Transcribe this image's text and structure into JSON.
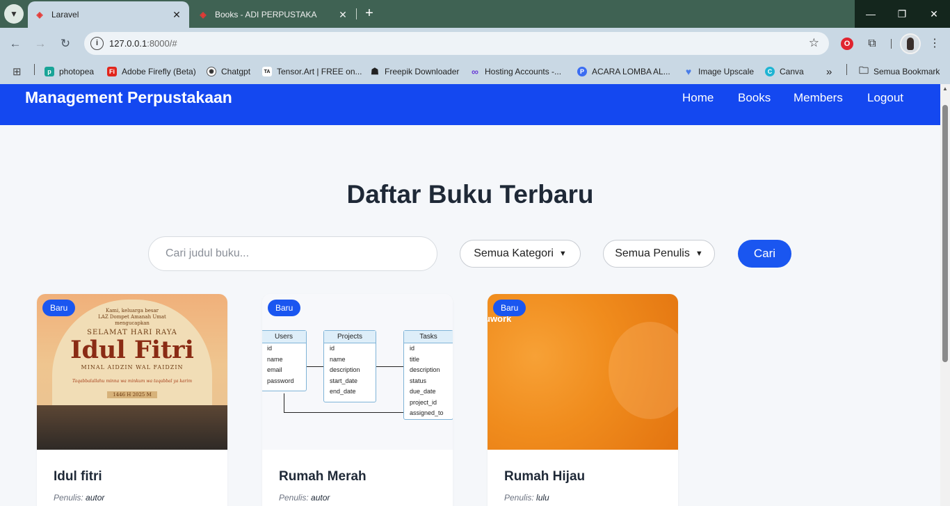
{
  "browser": {
    "tabs": [
      {
        "title": "Laravel",
        "active": true
      },
      {
        "title": "Books - ADI PERPUSTAKA",
        "active": false
      }
    ],
    "url_host": "127.0.0.1",
    "url_rest": ":8000/#",
    "bookmarks": [
      "photopea",
      "Adobe Firefly (Beta)",
      "Chatgpt",
      "Tensor.Art | FREE on...",
      "Freepik Downloader",
      "Hosting Accounts -...",
      "ACARA LOMBA AL...",
      "Image Upscale",
      "Canva"
    ],
    "all_bookmarks": "Semua Bookmark",
    "more_bookmarks": "»"
  },
  "navbar": {
    "brand": "Management Perpustakaan",
    "links": [
      "Home",
      "Books",
      "Members",
      "Logout"
    ]
  },
  "main": {
    "heading": "Daftar Buku Terbaru",
    "search_placeholder": "Cari judul buku...",
    "category_select": "Semua Kategori",
    "author_select": "Semua Penulis",
    "search_button": "Cari",
    "author_prefix": "Penulis:",
    "books": [
      {
        "badge": "Baru",
        "title": "Idul fitri",
        "author": "autor"
      },
      {
        "badge": "Baru",
        "title": "Rumah Merah",
        "author": "autor"
      },
      {
        "badge": "Baru",
        "title": "Rumah Hijau",
        "author": "lulu"
      }
    ]
  },
  "covers": {
    "idul_fitri": {
      "line1": "Kami, keluarga besar",
      "line2": "LAZ Dompet Amanah Umat",
      "line3": "mengucapkan",
      "greeting": "SELAMAT HARI RAYA",
      "big": "Idul Fitri",
      "sub": "MINAL AIDZIN WAL FAIDZIN",
      "doa": "Taqabbalallahu minna wa minkum wa taqabbal ya karim",
      "date": "1446 H   2025 M"
    },
    "erd": {
      "tables": [
        {
          "name": "Users",
          "fields": [
            "id",
            "name",
            "email",
            "password"
          ]
        },
        {
          "name": "Projects",
          "fields": [
            "id",
            "name",
            "description",
            "start_date",
            "end_date"
          ]
        },
        {
          "name": "Tasks",
          "fields": [
            "id",
            "title",
            "description",
            "status",
            "due_date",
            "project_id",
            "assigned_to"
          ]
        }
      ]
    },
    "orange": {
      "watermark": "uwork"
    }
  },
  "colors": {
    "navbar": "#1448f0",
    "accent": "#1a56f0",
    "page_bg": "#f5f7fa",
    "heading": "#1f2937"
  }
}
